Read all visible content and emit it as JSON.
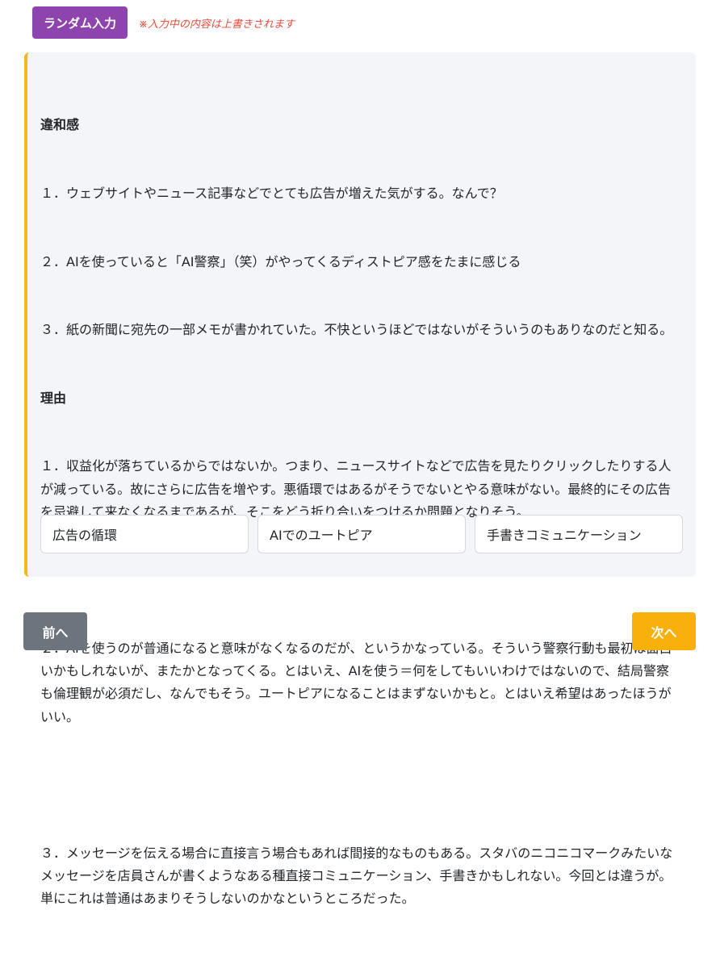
{
  "header": {
    "random_button": "ランダム入力",
    "warning": "※入力中の内容は上書きされます"
  },
  "card": {
    "section1_title": "違和感",
    "section1_lines": [
      "１．ウェブサイトやニュース記事などでとても広告が増えた気がする。なんで？",
      "２．AIを使っていると「AI警察」（笑）がやってくるディストピア感をたまに感じる",
      "３．紙の新聞に宛先の一部メモが書かれていた。不快というほどではないがそういうのもありなのだと知る。"
    ],
    "section2_title": "理由",
    "section2_lines": [
      "１．収益化が落ちているからではないか。つまり、ニュースサイトなどで広告を見たりクリックしたりする人が減っている。故にさらに広告を増やす。悪循環ではあるがそうでないとやる意味がない。最終的にその広告を忌避して来なくなるまであるが、そこをどう折り合いをつけるか問題となりそう。",
      "",
      "２．AIを使うのが普通になると意味がなくなるのだが、というかなっている。そういう警察行動も最初は面白いかもしれないが、またかとなってくる。とはいえ、AIを使う＝何をしてもいいわけではないので、結局警察も倫理観が必須だし、なんでもそう。ユートピアになることはまずないかもと。とはいえ希望はあったほうがいい。",
      "",
      "３．メッセージを伝える場合に直接言う場合もあれば間接的なものもある。スタバのニコニコマークみたいなメッセージを店員さんが書くようなある種直接コミュニケーション、手書きかもしれない。今回とは違うが。単にこれは普通はあまりそうしないのかなというところだった。"
    ],
    "options": [
      "広告の循環",
      "AIでのユートピア",
      "手書きコミュニケーション"
    ]
  },
  "footer": {
    "prev_button": "前へ",
    "next_button": "次へ"
  },
  "colors": {
    "random_button": "#8e44ad",
    "warning": "#e74c3c",
    "card_accent": "#f6b81a",
    "card_bg": "#f4f5f9",
    "prev_button": "#6c757d",
    "next_button": "#f7b10a"
  }
}
